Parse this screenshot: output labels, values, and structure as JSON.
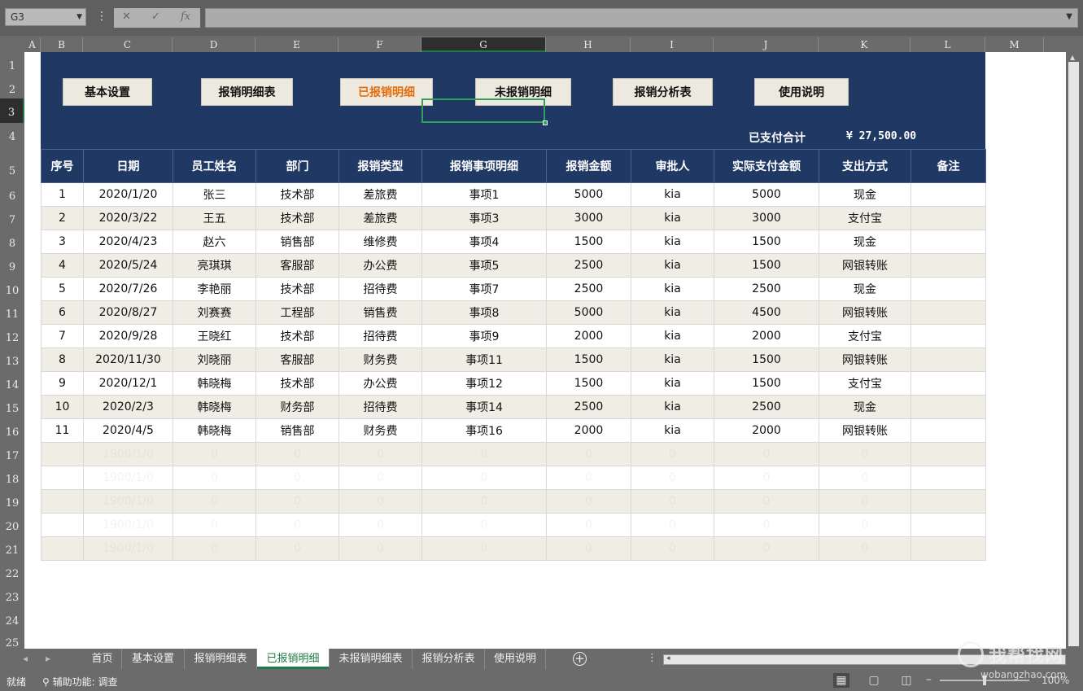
{
  "formula_bar": {
    "name_box": "G3",
    "cancel_icon": "✕",
    "enter_icon": "✓",
    "fx_icon": "fx"
  },
  "columns": [
    "A",
    "B",
    "C",
    "D",
    "E",
    "F",
    "G",
    "H",
    "I",
    "J",
    "K",
    "L",
    "M"
  ],
  "rows": [
    "1",
    "2",
    "3",
    "4",
    "5",
    "6",
    "7",
    "8",
    "9",
    "10",
    "11",
    "12",
    "13",
    "14",
    "15",
    "16",
    "17",
    "18",
    "19",
    "20",
    "21",
    "22",
    "23",
    "24",
    "25"
  ],
  "nav": {
    "basic_settings": "基本设置",
    "reimburse_detail": "报销明细表",
    "reimbursed_detail": "已报销明细",
    "unreimbursed_detail": "未报销明细",
    "analysis": "报销分析表",
    "instructions": "使用说明"
  },
  "summary": {
    "paid_label": "已支付合计",
    "paid_value": "¥ 27,500.00"
  },
  "table": {
    "headers": [
      "序号",
      "日期",
      "员工姓名",
      "部门",
      "报销类型",
      "报销事项明细",
      "报销金额",
      "审批人",
      "实际支付金额",
      "支出方式",
      "备注"
    ],
    "rows": [
      [
        "1",
        "2020/1/20",
        "张三",
        "技术部",
        "差旅费",
        "事项1",
        "5000",
        "kia",
        "5000",
        "现金",
        ""
      ],
      [
        "2",
        "2020/3/22",
        "王五",
        "技术部",
        "差旅费",
        "事项3",
        "3000",
        "kia",
        "3000",
        "支付宝",
        ""
      ],
      [
        "3",
        "2020/4/23",
        "赵六",
        "销售部",
        "维修费",
        "事项4",
        "1500",
        "kia",
        "1500",
        "现金",
        ""
      ],
      [
        "4",
        "2020/5/24",
        "亮琪琪",
        "客服部",
        "办公费",
        "事项5",
        "2500",
        "kia",
        "1500",
        "网银转账",
        ""
      ],
      [
        "5",
        "2020/7/26",
        "李艳丽",
        "技术部",
        "招待费",
        "事项7",
        "2500",
        "kia",
        "2500",
        "现金",
        ""
      ],
      [
        "6",
        "2020/8/27",
        "刘赛赛",
        "工程部",
        "销售费",
        "事项8",
        "5000",
        "kia",
        "4500",
        "网银转账",
        ""
      ],
      [
        "7",
        "2020/9/28",
        "王晓红",
        "技术部",
        "招待费",
        "事项9",
        "2000",
        "kia",
        "2000",
        "支付宝",
        ""
      ],
      [
        "8",
        "2020/11/30",
        "刘晓丽",
        "客服部",
        "财务费",
        "事项11",
        "1500",
        "kia",
        "1500",
        "网银转账",
        ""
      ],
      [
        "9",
        "2020/12/1",
        "韩晓梅",
        "技术部",
        "办公费",
        "事项12",
        "1500",
        "kia",
        "1500",
        "支付宝",
        ""
      ],
      [
        "10",
        "2020/2/3",
        "韩晓梅",
        "财务部",
        "招待费",
        "事项14",
        "2500",
        "kia",
        "2500",
        "现金",
        ""
      ],
      [
        "11",
        "2020/4/5",
        "韩晓梅",
        "销售部",
        "财务费",
        "事项16",
        "2000",
        "kia",
        "2000",
        "网银转账",
        ""
      ],
      [
        "",
        "1900/1/0",
        "0",
        "0",
        "0",
        "0",
        "0",
        "0",
        "0",
        "0",
        ""
      ],
      [
        "",
        "1900/1/0",
        "0",
        "0",
        "0",
        "0",
        "0",
        "0",
        "0",
        "0",
        ""
      ],
      [
        "",
        "1900/1/0",
        "0",
        "0",
        "0",
        "0",
        "0",
        "0",
        "0",
        "0",
        ""
      ],
      [
        "",
        "1900/1/0",
        "0",
        "0",
        "0",
        "0",
        "0",
        "0",
        "0",
        "0",
        ""
      ],
      [
        "",
        "1900/1/0",
        "0",
        "0",
        "0",
        "0",
        "0",
        "0",
        "0",
        "0",
        ""
      ]
    ]
  },
  "tabs": [
    "首页",
    "基本设置",
    "报销明细表",
    "已报销明细",
    "未报销明细表",
    "报销分析表",
    "使用说明"
  ],
  "active_tab": "已报销明细",
  "status": {
    "ready": "就绪",
    "accessibility": "辅助功能: 调查",
    "zoom": "100%"
  },
  "watermark": {
    "title": "我帮找网",
    "url": "wobangzhao.com"
  },
  "colors": {
    "banner": "#1f3864",
    "accent": "#1f7a45",
    "active_nav": "#e46c0a",
    "stripe": "#f0eee4"
  }
}
